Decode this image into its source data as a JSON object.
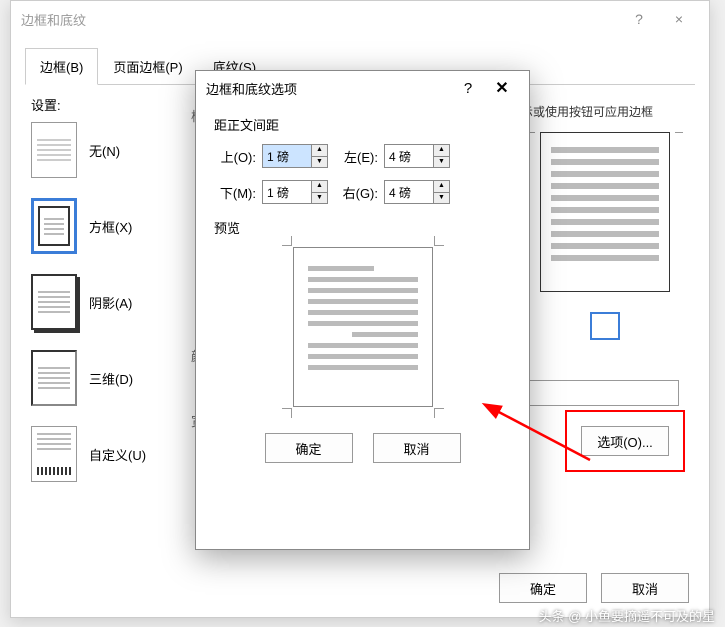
{
  "main": {
    "title": "边框和底纹",
    "help": "?",
    "close": "×",
    "tabs": {
      "borders": "边框(B)",
      "page_borders": "页面边框(P)",
      "shading": "底纹(S)"
    },
    "settings_label": "设置:",
    "style_label": "样",
    "color_label": "颜",
    "width_label": "宽",
    "settings": {
      "none": "无(N)",
      "box": "方框(X)",
      "shadow": "阴影(A)",
      "threed": "三维(D)",
      "custom": "自定义(U)"
    },
    "preview_hint": "示或使用按钮可应用边框",
    "options_btn": "选项(O)...",
    "ok": "确定",
    "cancel": "取消"
  },
  "sub": {
    "title": "边框和底纹选项",
    "help": "?",
    "close": "✕",
    "margin_label": "距正文间距",
    "top_label": "上(O):",
    "bottom_label": "下(M):",
    "left_label": "左(E):",
    "right_label": "右(G):",
    "top_val": "1 磅",
    "bottom_val": "1 磅",
    "left_val": "4 磅",
    "right_val": "4 磅",
    "preview_label": "预览",
    "ok": "确定",
    "cancel": "取消"
  },
  "watermark": "头条 @ 小鱼要摘遥不可及的星"
}
